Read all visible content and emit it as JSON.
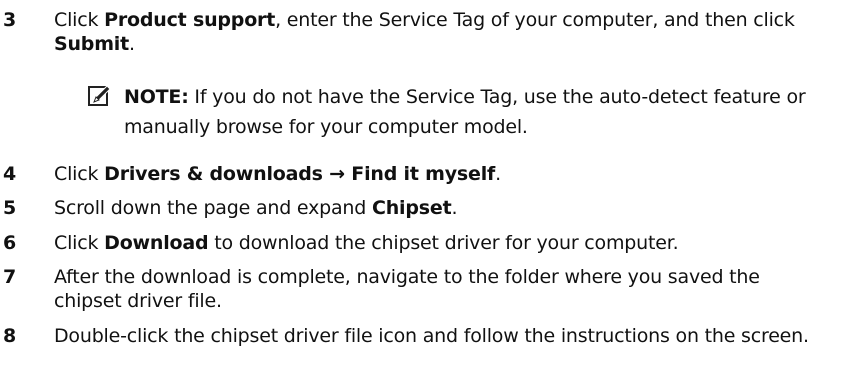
{
  "steps": [
    {
      "number": "3",
      "parts": [
        "Click ",
        "Product support",
        ", enter the Service Tag of your computer, and then click ",
        "Submit",
        "."
      ]
    },
    {
      "number": "4",
      "parts": [
        "Click ",
        "Drivers & downloads → Find it myself",
        "."
      ]
    },
    {
      "number": "5",
      "parts": [
        "Scroll down the page and expand ",
        "Chipset",
        "."
      ]
    },
    {
      "number": "6",
      "parts": [
        "Click ",
        "Download",
        " to download the chipset driver for your computer."
      ]
    },
    {
      "number": "7",
      "parts": [
        "After the download is complete, navigate to the folder where you saved the chipset driver file."
      ]
    },
    {
      "number": "8",
      "parts": [
        "Double-click the chipset driver file icon and follow the instructions on the screen."
      ]
    }
  ],
  "note": {
    "icon": "note-pencil-icon",
    "label": "NOTE:",
    "text": " If you do not have the Service Tag, use the auto-detect feature or manually browse for your computer model."
  }
}
